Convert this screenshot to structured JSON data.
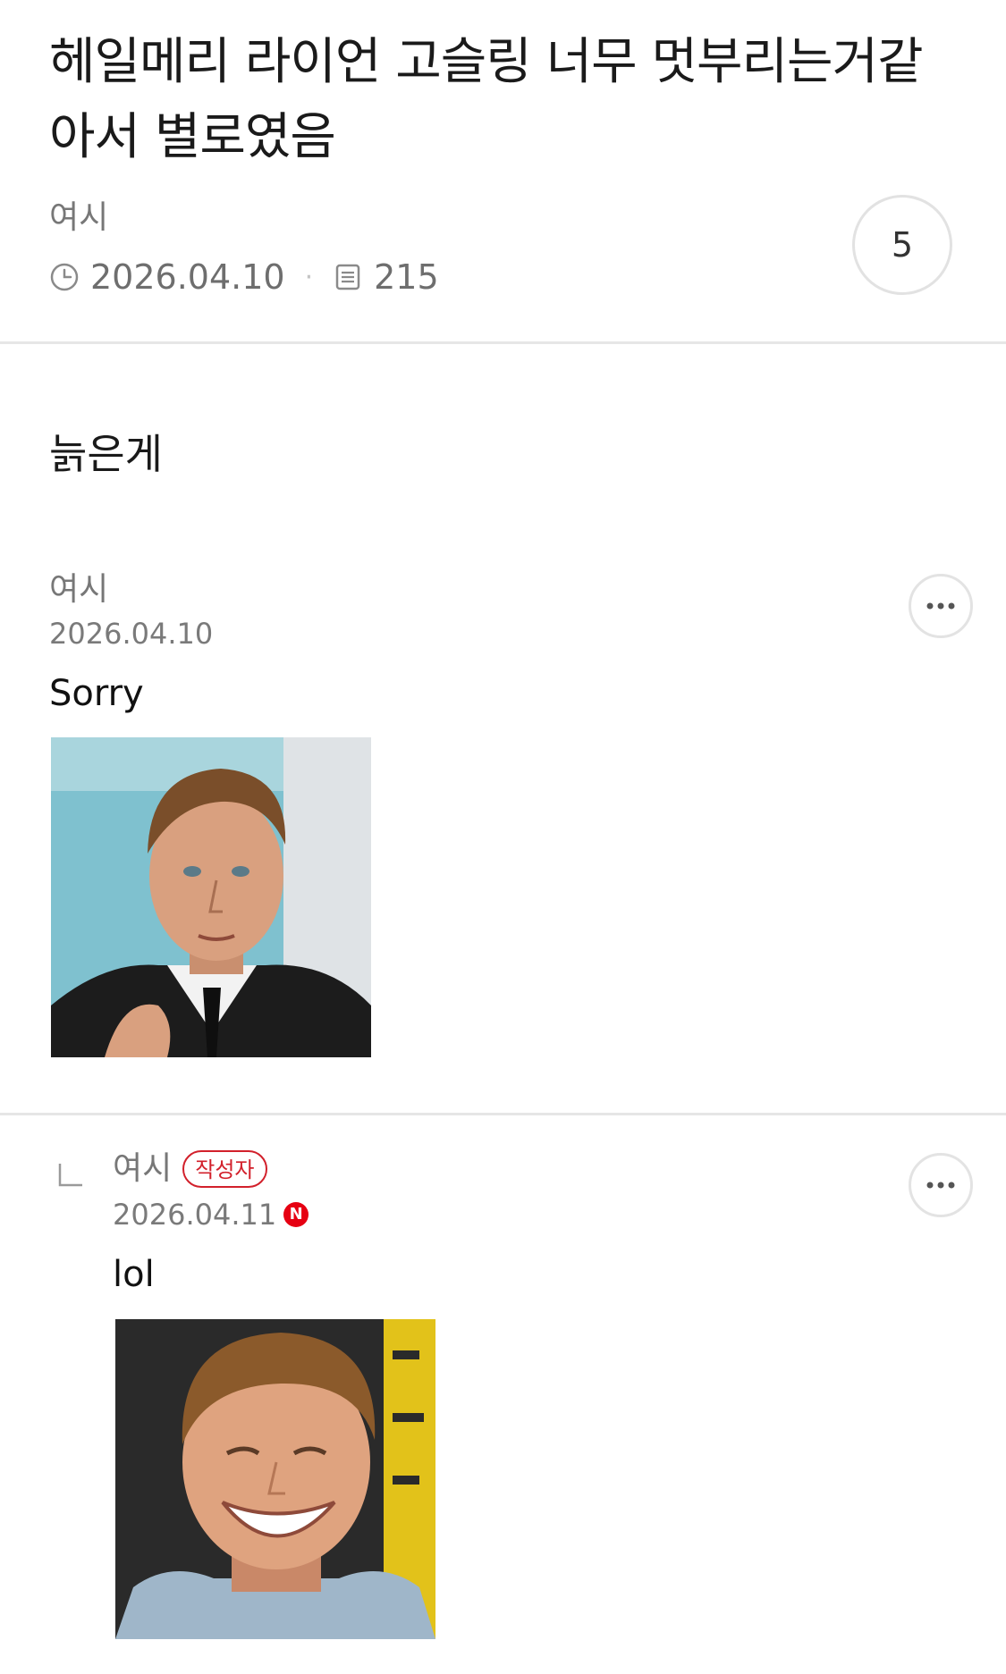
{
  "post": {
    "title": "헤일메리 라이언 고슬링 너무 멋부리는거같아서 별로였음",
    "author": "여시",
    "date": "2026.04.10",
    "views": "215",
    "comment_count": "5",
    "body": "늙은게",
    "icons": {
      "date": "clock-icon",
      "views": "document-icon"
    }
  },
  "comments": [
    {
      "author": "여시",
      "date": "2026.04.10",
      "text": "Sorry",
      "image": "photo of a man in a suit adjusting his tie",
      "more_icon": "more-dots-icon"
    },
    {
      "author": "여시",
      "badge": "작성자",
      "date": "2026.04.11",
      "new_badge": "N",
      "text": "lol",
      "image": "photo of a smiling man",
      "reply_icon": "reply-arrow-icon",
      "more_icon": "more-dots-icon"
    }
  ],
  "colors": {
    "accent_red": "#d2202b",
    "new_badge": "#e60012",
    "divider": "#e6e6e6"
  }
}
